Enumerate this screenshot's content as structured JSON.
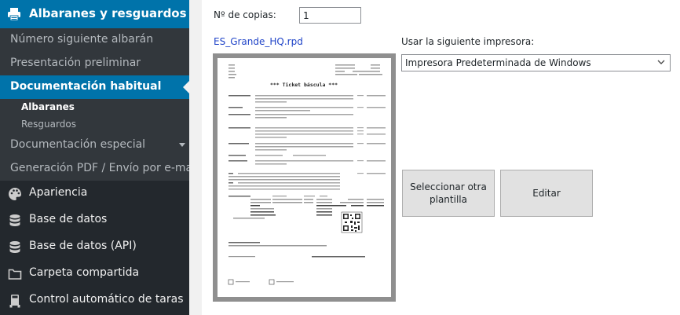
{
  "sidebar": {
    "header": {
      "label": "Albaranes y resguardos",
      "icon": "printer-icon"
    },
    "items": [
      {
        "label": "Número siguiente albarán"
      },
      {
        "label": "Presentación preliminar"
      },
      {
        "label": "Documentación habitual",
        "active": true
      },
      {
        "label": "Documentación especial",
        "has_submenu": true
      },
      {
        "label": "Generación PDF / Envío por e-mail"
      }
    ],
    "subitems": [
      {
        "label": "Albaranes",
        "current": true
      },
      {
        "label": "Resguardos"
      }
    ],
    "main_items": [
      {
        "label": "Apariencia",
        "icon": "palette-icon"
      },
      {
        "label": "Base de datos",
        "icon": "database-icon"
      },
      {
        "label": "Base de datos (API)",
        "icon": "database-icon"
      },
      {
        "label": "Carpeta compartida",
        "icon": "folder-icon"
      },
      {
        "label": "Control automático de taras",
        "icon": "truck-icon"
      }
    ],
    "colors": {
      "background": "#23282d",
      "submenu": "#32373c",
      "accent": "#0073aa"
    }
  },
  "main": {
    "copies_label": "Nº de copias:",
    "copies_value": "1",
    "template_name": "ES_Grande_HQ.rpd",
    "printer_label": "Usar la siguiente impresora:",
    "printer_value": "Impresora Predeterminada de Windows",
    "buttons": {
      "select_template": "Seleccionar otra plantilla",
      "edit": "Editar"
    },
    "preview": {
      "title": "*** Ticket báscula ***"
    }
  }
}
